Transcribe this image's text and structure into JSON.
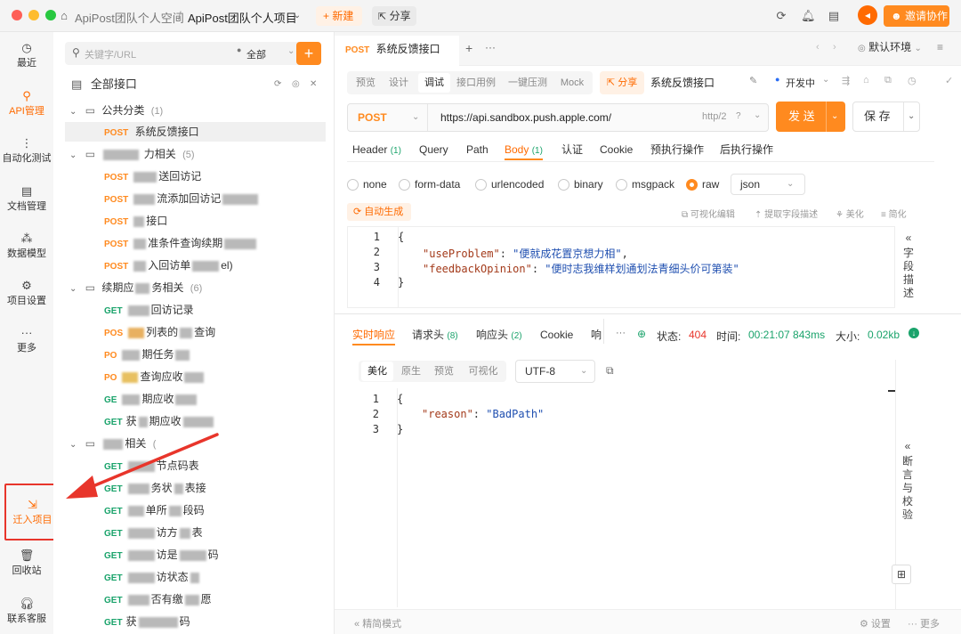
{
  "titlebar": {
    "workspace": "ApiPost团队个人空间",
    "separator": "/",
    "project": "ApiPost团队个人项目",
    "new_label": "新建",
    "share_label": "分享",
    "invite_label": "邀请协作"
  },
  "rail": {
    "items": [
      {
        "label": "最近",
        "icon": "clock-icon"
      },
      {
        "label": "API管理",
        "icon": "api-icon"
      },
      {
        "label": "自动化测试",
        "icon": "flow-icon"
      },
      {
        "label": "文档管理",
        "icon": "doc-icon"
      },
      {
        "label": "数据模型",
        "icon": "model-icon"
      },
      {
        "label": "项目设置",
        "icon": "settings-icon"
      },
      {
        "label": "更多",
        "icon": "more-icon"
      },
      {
        "label": "迁入项目",
        "icon": "import-icon"
      },
      {
        "label": "回收站",
        "icon": "trash-icon"
      },
      {
        "label": "联系客服",
        "icon": "headset-icon"
      }
    ]
  },
  "tree": {
    "search_placeholder": "关键字/URL",
    "filter": "全部",
    "root_label": "全部接口",
    "folders": [
      {
        "name": "公共分类",
        "count": "(1)"
      },
      {
        "name": "力相关",
        "count": "(5)"
      },
      {
        "name": "续期应",
        "name2": "务相关",
        "count": "(6)"
      },
      {
        "name": "相关",
        "count": "("
      }
    ],
    "items": [
      {
        "method": "POST",
        "text": "系统反馈接口"
      },
      {
        "method": "POST",
        "text": "送回访记"
      },
      {
        "method": "POST",
        "text": "流添加回访记"
      },
      {
        "method": "POST",
        "text": "接口"
      },
      {
        "method": "POST",
        "text": "准条件查询续期"
      },
      {
        "method": "POST",
        "text": "入回访单",
        "tail": "el)"
      },
      {
        "method": "GET",
        "text": "回访记录"
      },
      {
        "method": "POS",
        "text": "列表的",
        "tail": "查询"
      },
      {
        "method": "PO",
        "text": "期任务"
      },
      {
        "method": "PO",
        "text": "查询应收"
      },
      {
        "method": "GE",
        "text": "期应收"
      },
      {
        "method": "GET",
        "text": "获",
        "tail": "期应收"
      },
      {
        "method": "GET",
        "text": "节点码表"
      },
      {
        "method": "GET",
        "text": "务状",
        "tail": "表接"
      },
      {
        "method": "GET",
        "text": "单所",
        "tail": "段码"
      },
      {
        "method": "GET",
        "text": "访方",
        "tail": "表"
      },
      {
        "method": "GET",
        "text": "访是",
        "tail": "码"
      },
      {
        "method": "GET",
        "text": "访状态"
      },
      {
        "method": "GET",
        "text": "否有缴",
        "tail": "愿"
      },
      {
        "method": "GET",
        "text": "获",
        "tail": "码"
      }
    ]
  },
  "main": {
    "doc_tab": {
      "method": "POST",
      "title": "系统反馈接口"
    },
    "env_label": "默认环境",
    "mode_tabs": [
      "预览",
      "设计",
      "调试",
      "接口用例",
      "一键压测",
      "Mock"
    ],
    "share_label": "分享",
    "api_name": "系统反馈接口",
    "dev_label": "开发中",
    "method": "POST",
    "url": "https://api.sandbox.push.apple.com/",
    "http_version": "http/2",
    "send_label": "发 送",
    "save_label": "保 存",
    "req_tabs": [
      {
        "label": "Header",
        "count": "(1)"
      },
      {
        "label": "Query",
        "count": ""
      },
      {
        "label": "Path",
        "count": ""
      },
      {
        "label": "Body",
        "count": "(1)"
      },
      {
        "label": "认证",
        "count": ""
      },
      {
        "label": "Cookie",
        "count": ""
      },
      {
        "label": "预执行操作",
        "count": ""
      },
      {
        "label": "后执行操作",
        "count": ""
      }
    ],
    "body_types": [
      "none",
      "form-data",
      "urlencoded",
      "binary",
      "msgpack",
      "raw"
    ],
    "raw_format": "json",
    "auto_gen": "自动生成",
    "body_tools": [
      "可视化编辑",
      "提取字段描述",
      "美化",
      "简化"
    ],
    "field_desc": "字段描述",
    "body_lines": {
      "l1": "{",
      "l2_key": "\"useProblem\"",
      "l2_val": "\"便就成花置京想力相\"",
      "l3_key": "\"feedbackOpinion\"",
      "l3_val": "\"便时志我维样划通划法青细头价可第装\"",
      "l4": "}"
    },
    "resp_tabs": [
      {
        "label": "实时响应",
        "count": ""
      },
      {
        "label": "请求头",
        "count": "(8)"
      },
      {
        "label": "响应头",
        "count": "(2)"
      },
      {
        "label": "Cookie",
        "count": ""
      },
      {
        "label": "响",
        "count": ""
      }
    ],
    "status_label": "状态:",
    "status_value": "404",
    "time_label": "时间:",
    "time_value": "00:21:07 843ms",
    "size_label": "大小:",
    "size_value": "0.02kb",
    "view_tabs": [
      "美化",
      "原生",
      "预览",
      "可视化"
    ],
    "encoding": "UTF-8",
    "resp_lines": {
      "l1": "{",
      "l2_key": "\"reason\"",
      "l2_val": "\"BadPath\"",
      "l3": "}"
    },
    "assert_label": "断言与校验",
    "footer_simple": "精简模式",
    "footer_settings": "设置",
    "footer_more": "更多",
    "accent": "#ff8a1f"
  }
}
